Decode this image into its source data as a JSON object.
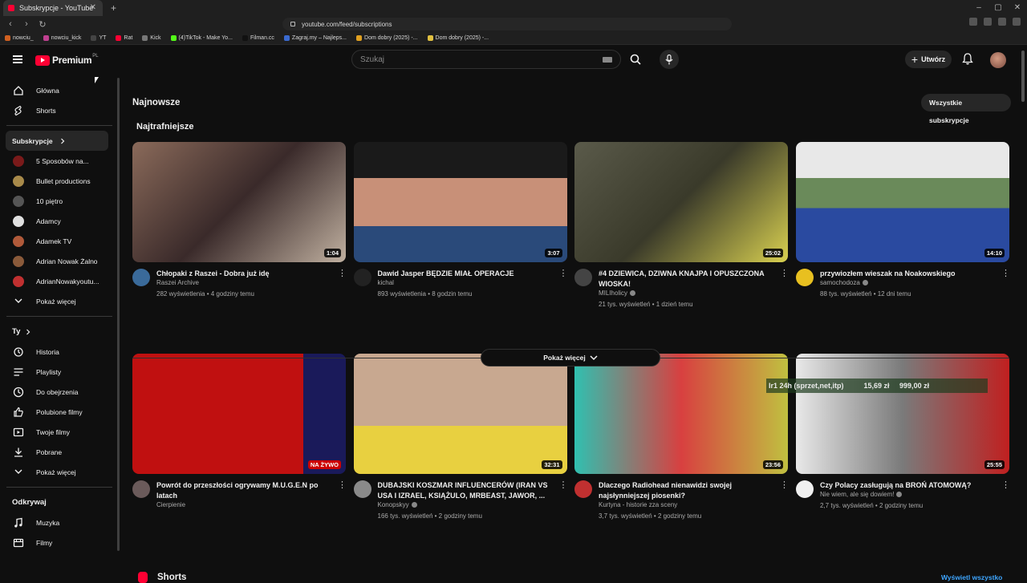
{
  "browser": {
    "tab_title": "Subskrypcje - YouTube",
    "url": "youtube.com/feed/subscriptions",
    "bookmarks": [
      "nowciu_",
      "nowciu_kick",
      "YT",
      "Rat",
      "Kick",
      "(4)TikTok - Make Yo...",
      "Filman.cc",
      "Zagraj.my – Najleps...",
      "Dom dobry (2025) -...",
      "Dom dobry (2025) -..."
    ]
  },
  "masthead": {
    "logo_text": "Premium",
    "country": "PL",
    "search_placeholder": "Szukaj",
    "create_label": "Utwórz"
  },
  "sidebar": {
    "main": [
      {
        "label": "Główna",
        "icon": "home-icon"
      },
      {
        "label": "Shorts",
        "icon": "shorts-icon"
      }
    ],
    "subs_header": "Subskrypcje",
    "subs": [
      {
        "label": "5 Sposobów na...",
        "color": "#7a1a1a"
      },
      {
        "label": "Bullet productions",
        "color": "#a88a4a"
      },
      {
        "label": "10 piętro",
        "color": "#555555"
      },
      {
        "label": "Adamcy",
        "color": "#e0e0e0"
      },
      {
        "label": "Adamek TV",
        "color": "#b05a3a"
      },
      {
        "label": "Adrian Nowak Żalno",
        "color": "#8a5a3a"
      },
      {
        "label": "AdrianNowakyoutu...",
        "color": "#c03030"
      }
    ],
    "subs_more": "Pokaż więcej",
    "you_header": "Ty",
    "you": [
      {
        "label": "Historia",
        "icon": "history-icon"
      },
      {
        "label": "Playlisty",
        "icon": "playlist-icon"
      },
      {
        "label": "Do obejrzenia",
        "icon": "watch-later-icon"
      },
      {
        "label": "Polubione filmy",
        "icon": "like-icon"
      },
      {
        "label": "Twoje filmy",
        "icon": "your-videos-icon"
      },
      {
        "label": "Pobrane",
        "icon": "download-icon"
      }
    ],
    "you_more": "Pokaż więcej",
    "explore_header": "Odkrywaj",
    "explore": [
      {
        "label": "Muzyka",
        "icon": "music-icon"
      },
      {
        "label": "Filmy",
        "icon": "movies-icon"
      }
    ]
  },
  "content": {
    "latest_heading": "Najnowsze",
    "all_subs_button": "Wszystkie subskrypcje",
    "best_heading": "Najtrafniejsze",
    "show_more": "Pokaż więcej",
    "shorts_heading": "Shorts",
    "view_all": "Wyświetl wszystko",
    "overlay_text": "Ir1 24h (sprzet,net,itp)          15,69 zł     999,00 zł",
    "videos": [
      {
        "title": "Chłopaki z Raszei - Dobra już idę",
        "channel": "Raszei Archive",
        "stats": "282 wyświetlenia • 4 godziny temu",
        "duration": "1:04",
        "thumb": "linear-gradient(135deg,#8a6a5a,#3a2a2a 50%,#c0b0a0)",
        "avatar": "#3a6a9a",
        "verified": false
      },
      {
        "title": "Dawid Jasper BĘDZIE MIAŁ OPERACJE",
        "channel": "kichal",
        "stats": "893 wyświetlenia • 8 godzin temu",
        "duration": "3:07",
        "thumb": "linear-gradient(180deg,#1a1a1a 0 30%,#c89078 30% 70%,#2a4a7a 70%)",
        "avatar": "#222222",
        "verified": false
      },
      {
        "title": "#4 DZIEWICA, DZIWNA KNAJPA I OPUSZCZONA WIOSKA!",
        "channel": "MILIholicy",
        "stats": "21 tys. wyświetleń • 1 dzień temu",
        "duration": "25:02",
        "thumb": "linear-gradient(135deg,#5a5a4a,#3a3a2a 50%,#d8d050)",
        "avatar": "#444444",
        "verified": true
      },
      {
        "title": "przywiozłem wieszak na Noakowskiego",
        "channel": "samochodoza",
        "stats": "88 tys. wyświetleń • 12 dni temu",
        "duration": "14:10",
        "thumb": "linear-gradient(180deg,#e8e8e8 0 30%,#6a8a5a 30% 55%,#2a4aa0 55%)",
        "avatar": "#e8c020",
        "verified": true
      },
      {
        "title": "Powrót do przeszłości ogrywamy M.U.G.E.N po latach",
        "channel": "Cierpienie",
        "stats": "",
        "duration": "NA ŻYWO",
        "thumb": "linear-gradient(90deg,#c01010 0 80%,#1a1a5a 80%)",
        "avatar": "#6a5a5a",
        "verified": false
      },
      {
        "title": "DUBAJSKI KOSZMAR INFLUENCERÓW (IRAN VS USA I IZRAEL, KSIĄŻULO, MRBEAST, JAWOR, ...",
        "channel": "Konopskyy",
        "stats": "166 tys. wyświetleń • 2 godziny temu",
        "duration": "32:31",
        "thumb": "linear-gradient(180deg,#c8a890 0 60%,#e8d040 60%)",
        "avatar": "#8a8a8a",
        "verified": true
      },
      {
        "title": "Dlaczego Radiohead nienawidzi swojej najsłynniejszej piosenki?",
        "channel": "Kurtyna - historie zza sceny",
        "stats": "3,7 tys. wyświetleń • 2 godziny temu",
        "duration": "23:56",
        "thumb": "linear-gradient(90deg,#30c0b0,#d84040 50%,#c0c040)",
        "avatar": "#c03030",
        "verified": false
      },
      {
        "title": "Czy Polacy zasługują na BROŃ ATOMOWĄ?",
        "channel": "Nie wiem, ale się dowiem!",
        "stats": "2,7 tys. wyświetleń • 2 godziny temu",
        "duration": "25:55",
        "thumb": "linear-gradient(90deg,#e8e8e8,#7a7a7a 50%,#c02020)",
        "avatar": "#f0f0f0",
        "verified": true
      }
    ]
  }
}
